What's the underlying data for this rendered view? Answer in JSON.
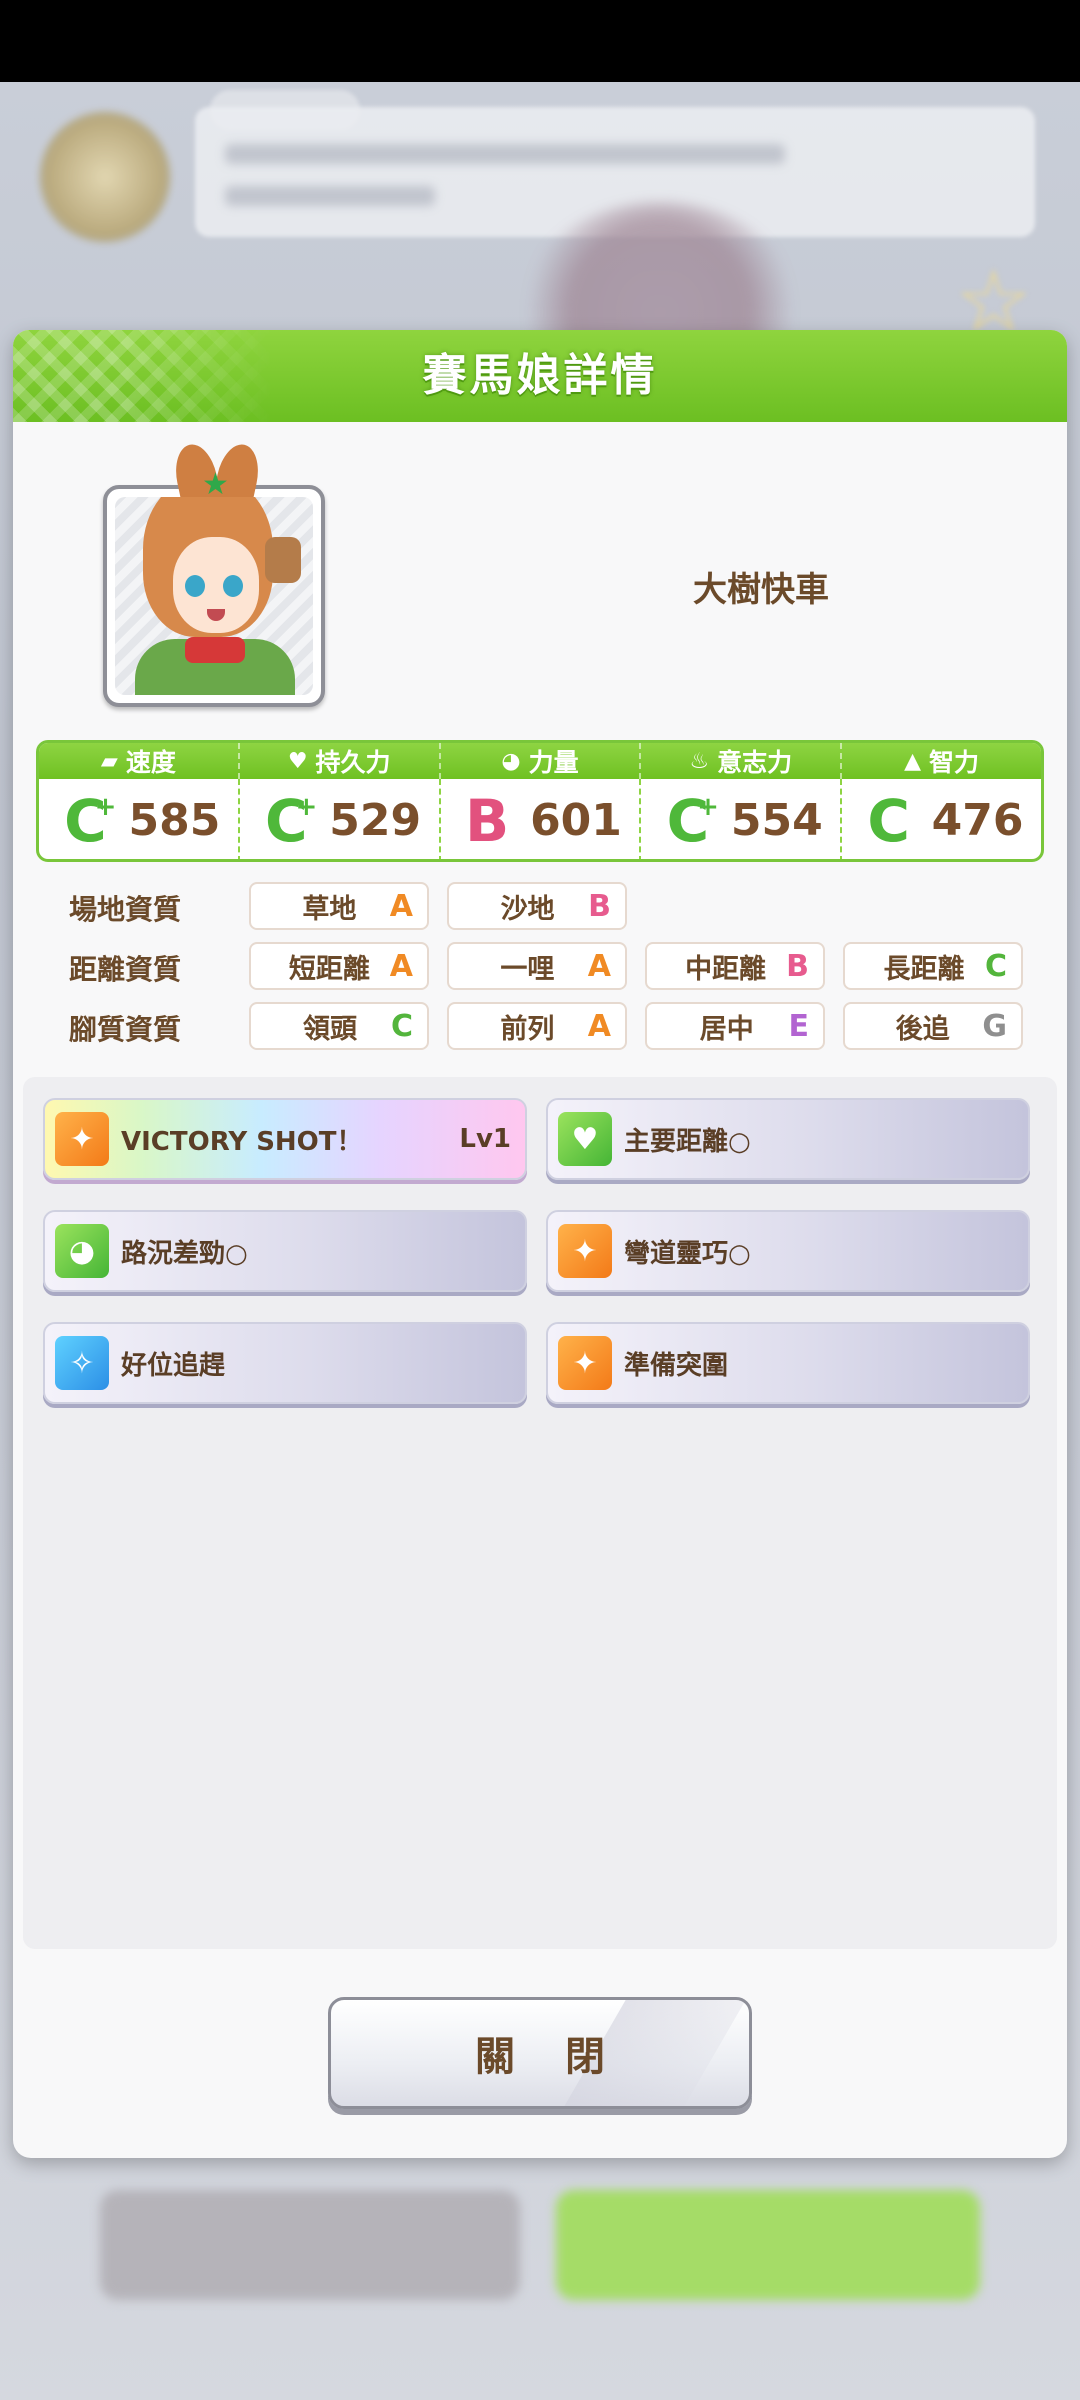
{
  "dialog": {
    "title": "賽馬娘詳情",
    "character_name": "大樹快車",
    "close_label": "關 閉"
  },
  "stats": [
    {
      "label": "速度",
      "icon": "shoe-icon",
      "grade": "C",
      "plus": true,
      "value": "585"
    },
    {
      "label": "持久力",
      "icon": "heart-icon",
      "grade": "C",
      "plus": true,
      "value": "529"
    },
    {
      "label": "力量",
      "icon": "muscle-icon",
      "grade": "B",
      "plus": false,
      "value": "601"
    },
    {
      "label": "意志力",
      "icon": "flame-icon",
      "grade": "C",
      "plus": true,
      "value": "554"
    },
    {
      "label": "智力",
      "icon": "graduation-cap-icon",
      "grade": "C",
      "plus": false,
      "value": "476"
    }
  ],
  "aptitudes": {
    "track": {
      "label": "場地資質",
      "items": [
        {
          "name": "草地",
          "grade": "A"
        },
        {
          "name": "沙地",
          "grade": "B"
        }
      ]
    },
    "distance": {
      "label": "距離資質",
      "items": [
        {
          "name": "短距離",
          "grade": "A"
        },
        {
          "name": "一哩",
          "grade": "A"
        },
        {
          "name": "中距離",
          "grade": "B"
        },
        {
          "name": "長距離",
          "grade": "C"
        }
      ]
    },
    "style": {
      "label": "腳質資質",
      "items": [
        {
          "name": "領頭",
          "grade": "C"
        },
        {
          "name": "前列",
          "grade": "A"
        },
        {
          "name": "居中",
          "grade": "E"
        },
        {
          "name": "後追",
          "grade": "G"
        }
      ]
    }
  },
  "skills": [
    {
      "name": "VICTORY SHOT！",
      "level": "Lv1",
      "icon": "runner-icon"
    },
    {
      "name": "主要距離○",
      "icon": "heart-icon"
    },
    {
      "name": "路況差勁○",
      "icon": "muscle-icon"
    },
    {
      "name": "彎道靈巧○",
      "icon": "runner-icon"
    },
    {
      "name": "好位追趕",
      "icon": "sparkle-icon"
    },
    {
      "name": "準備突圍",
      "icon": "runner-icon"
    }
  ]
}
